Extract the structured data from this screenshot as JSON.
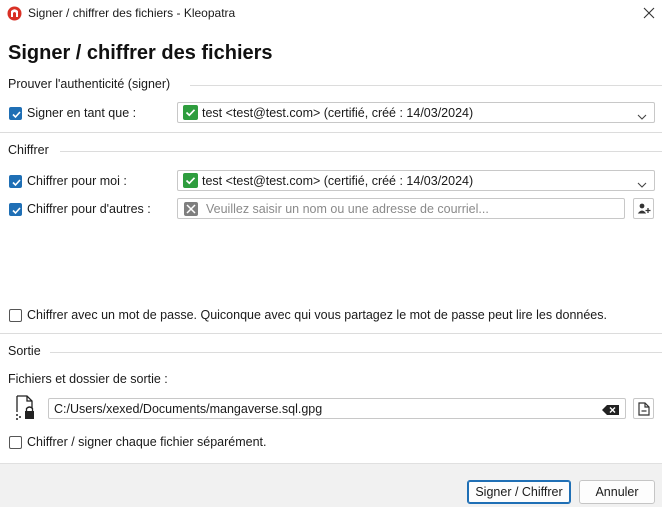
{
  "window": {
    "title": "Signer / chiffrer des fichiers - Kleopatra",
    "close_symbol": "✕"
  },
  "dialog": {
    "title": "Signer / chiffrer des fichiers"
  },
  "sign_section": {
    "header": "Prouver l'authenticité (signer)",
    "sign_as": {
      "label": "Signer en tant que :",
      "checked": true,
      "value": "test <test@test.com> (certifié, créé : 14/03/2024)"
    }
  },
  "encrypt_section": {
    "header": "Chiffrer",
    "for_me": {
      "label": "Chiffrer pour moi :",
      "checked": true,
      "value": "test <test@test.com> (certifié, créé : 14/03/2024)"
    },
    "for_others": {
      "label": "Chiffrer pour d'autres :",
      "checked": true,
      "placeholder": "Veuillez saisir un nom ou une adresse de courriel..."
    },
    "with_password": {
      "label": "Chiffrer avec un mot de passe. Quiconque avec qui vous partagez le mot de passe peut lire les données.",
      "checked": false
    }
  },
  "output_section": {
    "header": "Sortie",
    "files_label": "Fichiers et dossier de sortie :",
    "output_path": "C:/Users/xexed/Documents/mangaverse.sql.gpg",
    "separately": {
      "label": "Chiffrer / signer chaque fichier séparément.",
      "checked": false
    }
  },
  "footer": {
    "primary_label": "Signer / Chiffrer",
    "cancel_label": "Annuler"
  },
  "colors": {
    "accent": "#1f6fb5",
    "certified_green": "#2e9d3e"
  }
}
